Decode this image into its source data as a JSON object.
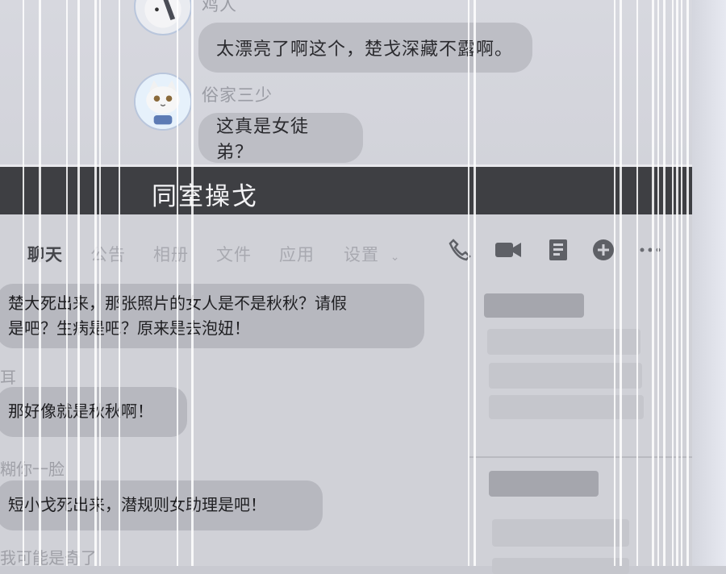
{
  "top_chat": {
    "messages": [
      {
        "sender": "鸡人",
        "text": "太漂亮了啊这个，楚戈深藏不露啊。"
      },
      {
        "sender": "俗家三少",
        "text": "这真是女徒弟？"
      }
    ]
  },
  "window_title": "同室操戈",
  "toolbar": {
    "tabs": [
      "聊天",
      "公告",
      "相册",
      "文件",
      "应用",
      "设置"
    ],
    "icons": [
      "phone-icon",
      "video-icon",
      "screen-share-icon",
      "add-icon",
      "more-icon"
    ]
  },
  "chat": {
    "messages": [
      {
        "name": "",
        "lines": [
          "楚大死出来，那张照片的女人是不是秋秋？请假",
          "是吧？生病是吧？原来是去泡妞！"
        ]
      },
      {
        "name": "耳",
        "lines": [
          "那好像就是秋秋啊！"
        ]
      },
      {
        "name": "糊你一脸",
        "lines": [
          "短小戈死出来，潜规则女助理是吧！"
        ]
      },
      {
        "name": "我可能是奇了",
        "lines": []
      }
    ]
  }
}
